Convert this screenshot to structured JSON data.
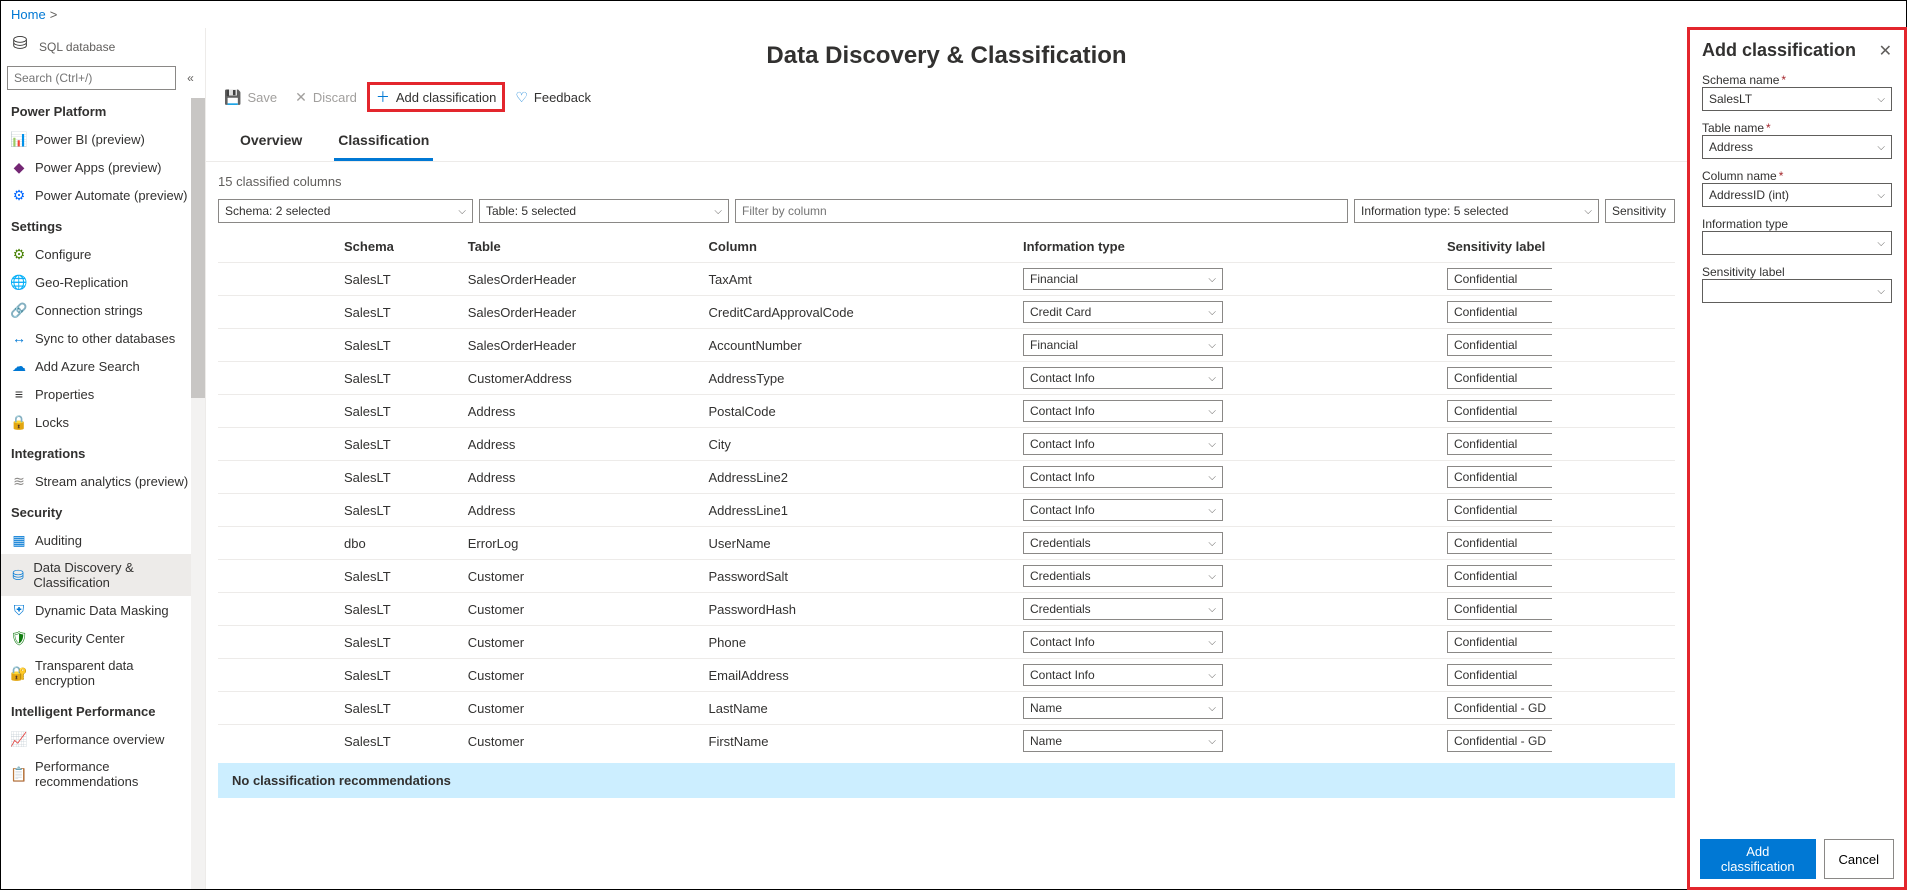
{
  "breadcrumb": {
    "home": "Home"
  },
  "resource": {
    "type": "SQL database"
  },
  "search": {
    "placeholder": "Search (Ctrl+/)"
  },
  "sidebar": {
    "groups": [
      {
        "title": "Power Platform",
        "items": [
          {
            "icon": "📊",
            "color": "#f2c811",
            "label": "Power BI (preview)"
          },
          {
            "icon": "◆",
            "color": "#742774",
            "label": "Power Apps (preview)"
          },
          {
            "icon": "⚙",
            "color": "#0066ff",
            "label": "Power Automate (preview)"
          }
        ]
      },
      {
        "title": "Settings",
        "items": [
          {
            "icon": "⚙",
            "color": "#498205",
            "label": "Configure"
          },
          {
            "icon": "🌐",
            "color": "#0078d4",
            "label": "Geo-Replication"
          },
          {
            "icon": "🔗",
            "color": "#323130",
            "label": "Connection strings"
          },
          {
            "icon": "↔",
            "color": "#0078d4",
            "label": "Sync to other databases"
          },
          {
            "icon": "☁",
            "color": "#0078d4",
            "label": "Add Azure Search"
          },
          {
            "icon": "≡",
            "color": "#323130",
            "label": "Properties"
          },
          {
            "icon": "🔒",
            "color": "#0078d4",
            "label": "Locks"
          }
        ]
      },
      {
        "title": "Integrations",
        "items": [
          {
            "icon": "≋",
            "color": "#8a8886",
            "label": "Stream analytics (preview)"
          }
        ]
      },
      {
        "title": "Security",
        "items": [
          {
            "icon": "▦",
            "color": "#0078d4",
            "label": "Auditing"
          },
          {
            "icon": "⛁",
            "color": "#0078d4",
            "label": "Data Discovery & Classification",
            "selected": true
          },
          {
            "icon": "⛨",
            "color": "#0078d4",
            "label": "Dynamic Data Masking"
          },
          {
            "icon": "🛡",
            "color": "#107c10",
            "label": "Security Center"
          },
          {
            "icon": "🔐",
            "color": "#0078d4",
            "label": "Transparent data encryption"
          }
        ]
      },
      {
        "title": "Intelligent Performance",
        "items": [
          {
            "icon": "📈",
            "color": "#0078d4",
            "label": "Performance overview"
          },
          {
            "icon": "📋",
            "color": "#0078d4",
            "label": "Performance recommendations"
          }
        ]
      }
    ]
  },
  "page": {
    "title": "Data Discovery & Classification"
  },
  "toolbar": {
    "save": "Save",
    "discard": "Discard",
    "add": "Add classification",
    "feedback": "Feedback"
  },
  "tabs": {
    "overview": "Overview",
    "classification": "Classification"
  },
  "summary": "15 classified columns",
  "filters": {
    "schema": "Schema: 2 selected",
    "table": "Table: 5 selected",
    "column_ph": "Filter by column",
    "info": "Information type: 5 selected",
    "sens": "Sensitivity la"
  },
  "columns": {
    "schema": "Schema",
    "table": "Table",
    "column": "Column",
    "info": "Information type",
    "sens": "Sensitivity label"
  },
  "rows": [
    {
      "schema": "SalesLT",
      "table": "SalesOrderHeader",
      "column": "TaxAmt",
      "info": "Financial",
      "sens": "Confidential"
    },
    {
      "schema": "SalesLT",
      "table": "SalesOrderHeader",
      "column": "CreditCardApprovalCode",
      "info": "Credit Card",
      "sens": "Confidential"
    },
    {
      "schema": "SalesLT",
      "table": "SalesOrderHeader",
      "column": "AccountNumber",
      "info": "Financial",
      "sens": "Confidential"
    },
    {
      "schema": "SalesLT",
      "table": "CustomerAddress",
      "column": "AddressType",
      "info": "Contact Info",
      "sens": "Confidential"
    },
    {
      "schema": "SalesLT",
      "table": "Address",
      "column": "PostalCode",
      "info": "Contact Info",
      "sens": "Confidential"
    },
    {
      "schema": "SalesLT",
      "table": "Address",
      "column": "City",
      "info": "Contact Info",
      "sens": "Confidential"
    },
    {
      "schema": "SalesLT",
      "table": "Address",
      "column": "AddressLine2",
      "info": "Contact Info",
      "sens": "Confidential"
    },
    {
      "schema": "SalesLT",
      "table": "Address",
      "column": "AddressLine1",
      "info": "Contact Info",
      "sens": "Confidential"
    },
    {
      "schema": "dbo",
      "table": "ErrorLog",
      "column": "UserName",
      "info": "Credentials",
      "sens": "Confidential"
    },
    {
      "schema": "SalesLT",
      "table": "Customer",
      "column": "PasswordSalt",
      "info": "Credentials",
      "sens": "Confidential"
    },
    {
      "schema": "SalesLT",
      "table": "Customer",
      "column": "PasswordHash",
      "info": "Credentials",
      "sens": "Confidential"
    },
    {
      "schema": "SalesLT",
      "table": "Customer",
      "column": "Phone",
      "info": "Contact Info",
      "sens": "Confidential"
    },
    {
      "schema": "SalesLT",
      "table": "Customer",
      "column": "EmailAddress",
      "info": "Contact Info",
      "sens": "Confidential"
    },
    {
      "schema": "SalesLT",
      "table": "Customer",
      "column": "LastName",
      "info": "Name",
      "sens": "Confidential - GDPR"
    },
    {
      "schema": "SalesLT",
      "table": "Customer",
      "column": "FirstName",
      "info": "Name",
      "sens": "Confidential - GDPR"
    }
  ],
  "recom": "No classification recommendations",
  "panel": {
    "title": "Add classification",
    "fields": {
      "schema": {
        "label": "Schema name",
        "value": "SalesLT"
      },
      "table": {
        "label": "Table name",
        "value": "Address"
      },
      "column": {
        "label": "Column name",
        "value": "AddressID (int)"
      },
      "info": {
        "label": "Information type",
        "value": ""
      },
      "sens": {
        "label": "Sensitivity label",
        "value": ""
      }
    },
    "add": "Add classification",
    "cancel": "Cancel"
  }
}
